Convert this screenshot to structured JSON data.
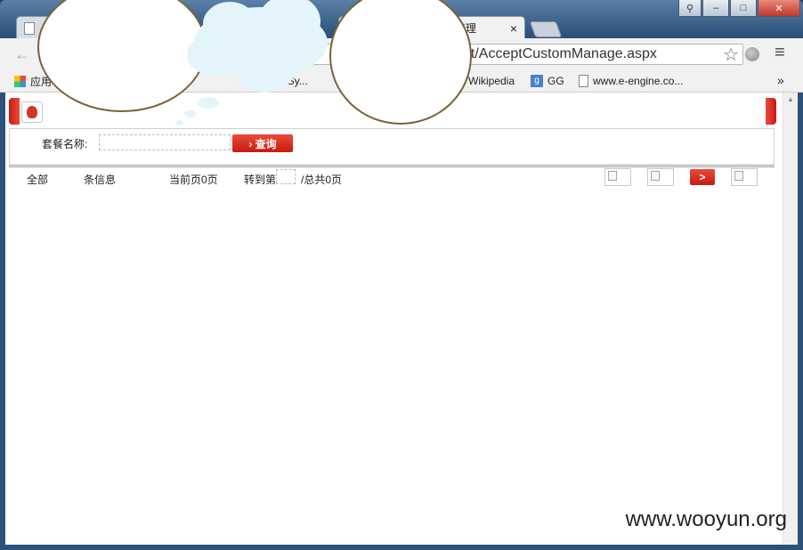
{
  "browser": {
    "tabs": [
      {
        "label": "",
        "active": false
      },
      {
        "label": "管理",
        "active": true
      }
    ],
    "tab_close": "×",
    "address_url": "pt/AcceptCustomManage.aspx",
    "star_glyph": "☆",
    "menu_glyph": "≡",
    "window_controls": {
      "user": "⚲",
      "minimize": "–",
      "maximize": "□",
      "close": "✕"
    },
    "bookmarks": [
      {
        "label": "应用",
        "icon": "apps-grid-icon"
      },
      {
        "label": "ed Sy...",
        "icon": "bookmark-icon"
      },
      {
        "label": "Wikipedia",
        "icon": "wikipedia-icon"
      },
      {
        "label": "GG",
        "icon": "google-icon"
      },
      {
        "label": "www.e-engine.co...",
        "icon": "page-icon"
      }
    ],
    "bookmarks_more": "»"
  },
  "page": {
    "search_label": "套餐名称:",
    "search_input_value": "",
    "search_button": "› 查询",
    "pager": {
      "all": "全部",
      "items": "条信息",
      "current_page": "当前页0页",
      "goto_prefix": "转到第",
      "goto_value": "",
      "total": "/总共0页",
      "go_button": ">"
    }
  },
  "watermark": "www.wooyun.org"
}
